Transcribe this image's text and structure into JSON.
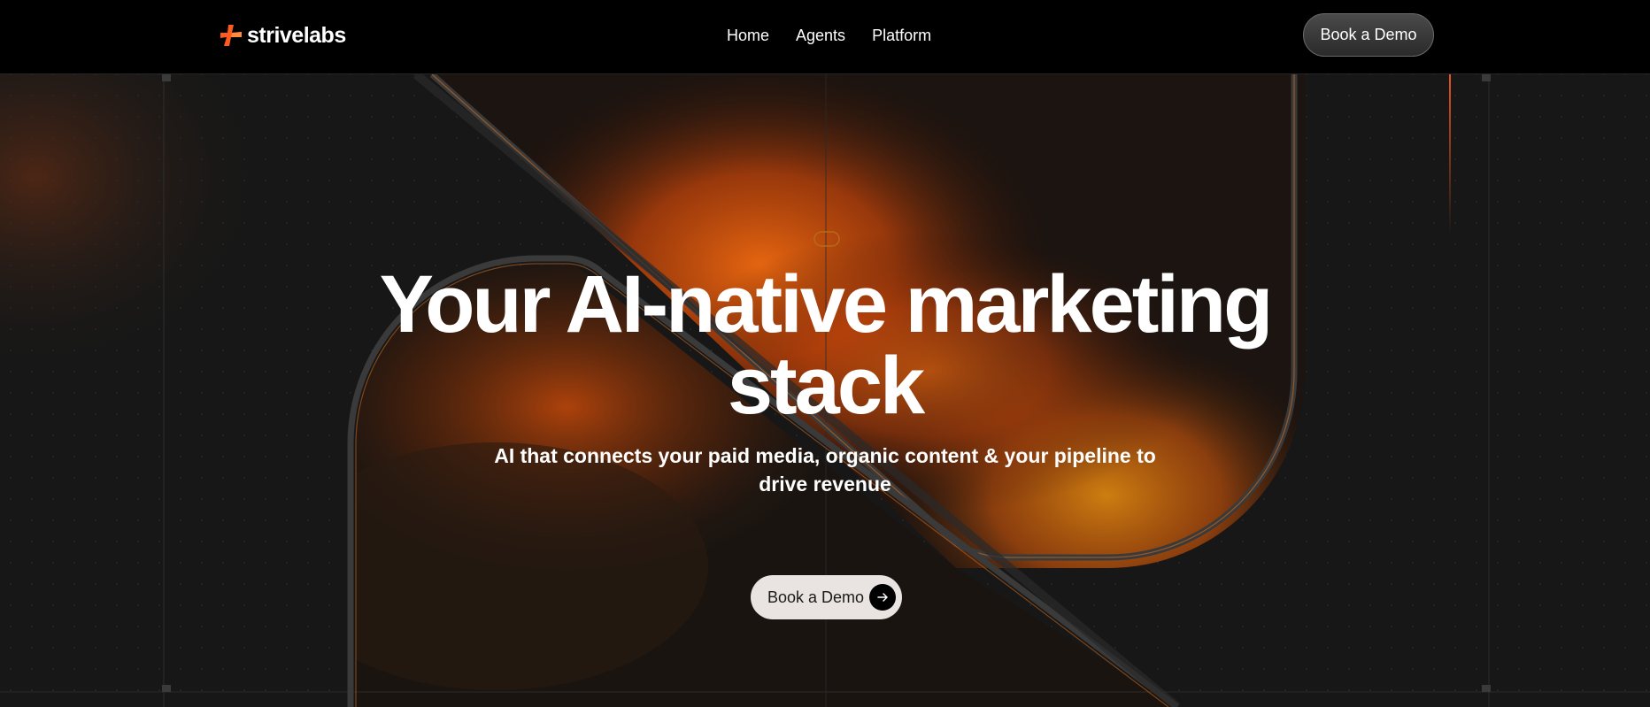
{
  "brand": {
    "name": "strivelabs",
    "accent": "#ff5a1f"
  },
  "nav": {
    "links": [
      {
        "label": "Home"
      },
      {
        "label": "Agents"
      },
      {
        "label": "Platform"
      }
    ],
    "cta_label": "Book a Demo"
  },
  "hero": {
    "headline": "Your AI-native marketing stack",
    "subheadline": "AI that connects your paid media, organic content & your pipeline to drive revenue",
    "cta_label": "Book a Demo",
    "cta_icon": "arrow-right-icon"
  },
  "colors": {
    "background": "#161616",
    "nav_background": "#000000",
    "glow_orange": "#e8580c",
    "glow_amber": "#d47a10",
    "cta_light": "#e9e4e1"
  }
}
